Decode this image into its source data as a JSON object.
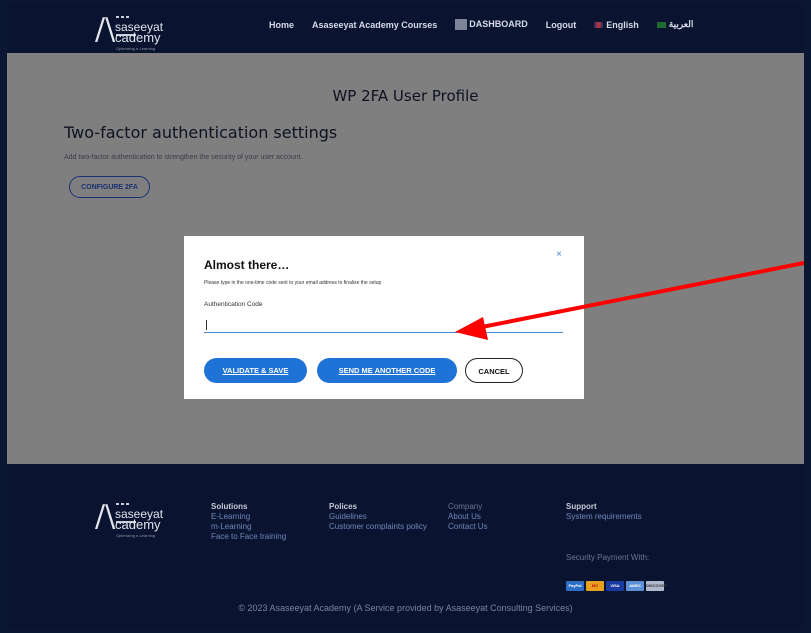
{
  "brand": {
    "line1": "saseeyat",
    "line2": "cademy",
    "tagline": "Optimizing e-Learning"
  },
  "nav": {
    "home": "Home",
    "courses": "Asaseeyat Academy Courses",
    "dashboard": "DASHBOARD",
    "logout": "Logout",
    "english": "English",
    "arabic": "العربية"
  },
  "content": {
    "page_heading": "WP 2FA User Profile",
    "section_title": "Two-factor authentication settings",
    "section_desc": "Add two-factor authentication to strengthen the security of your user account.",
    "configure_label": "CONFIGURE 2FA"
  },
  "modal": {
    "close_label": "×",
    "title": "Almost there…",
    "subtitle": "Please type in the one-time code sent to your email address to finalize the setup",
    "field_label": "Authentication Code",
    "field_value": "",
    "validate_label": "VALIDATE & SAVE",
    "send_label": "SEND ME ANOTHER CODE",
    "cancel_label": "CANCEL"
  },
  "footer": {
    "solutions": {
      "title": "Solutions",
      "items": [
        "E-Learning",
        "m-Learning",
        "Face to Face training"
      ]
    },
    "policies": {
      "title": "Polices",
      "items": [
        "Guidelines",
        "Customer complaints policy"
      ]
    },
    "company": {
      "title": "Company",
      "items": [
        "About Us",
        "Contact Us"
      ]
    },
    "support": {
      "title": "Support",
      "items": [
        "System requirements"
      ]
    },
    "security_text": "Security Payment With:",
    "cards": [
      "PayPal",
      "MC",
      "VISA",
      "AMEX",
      "DISCOVER"
    ],
    "copyright": "© 2023 Asaseeyat Academy (A Service provided by Asaseeyat Consulting Services)"
  },
  "colors": {
    "nav_bg": "#0a1430",
    "page_bg": "#7f7f7f",
    "primary_button": "#1f73d6",
    "annotation_arrow": "#ff0000"
  }
}
